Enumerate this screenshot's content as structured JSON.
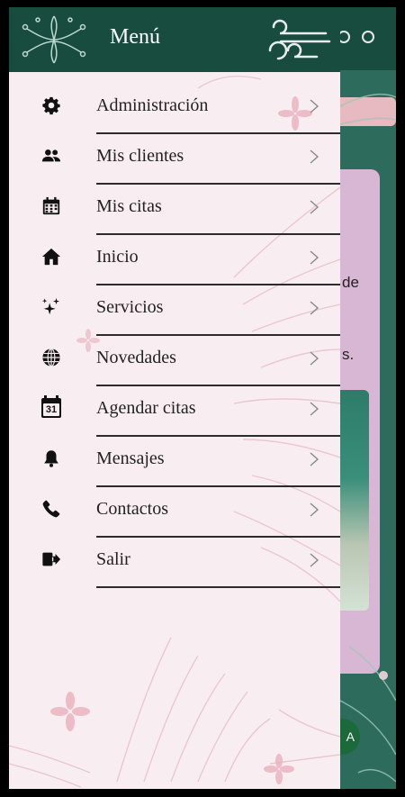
{
  "drawer": {
    "title": "Menú",
    "items": [
      {
        "label": "Administración",
        "icon": "gear-icon"
      },
      {
        "label": "Mis clientes",
        "icon": "users-icon"
      },
      {
        "label": "Mis citas",
        "icon": "calendar-icon"
      },
      {
        "label": "Inicio",
        "icon": "home-icon"
      },
      {
        "label": "Servicios",
        "icon": "sparkles-icon"
      },
      {
        "label": "Novedades",
        "icon": "globe-icon"
      },
      {
        "label": "Agendar citas",
        "icon": "calendar-31-icon"
      },
      {
        "label": "Mensajes",
        "icon": "bell-icon"
      },
      {
        "label": "Contactos",
        "icon": "phone-icon"
      },
      {
        "label": "Salir",
        "icon": "logout-icon"
      }
    ],
    "calendar_day": "31"
  },
  "background": {
    "text_fragment_1": "de",
    "text_fragment_2": "s.",
    "fab_text": "A"
  },
  "colors": {
    "header": "#174c3f",
    "drawer_bg": "#f8eef1",
    "accent_pink": "#e7b9c1"
  }
}
